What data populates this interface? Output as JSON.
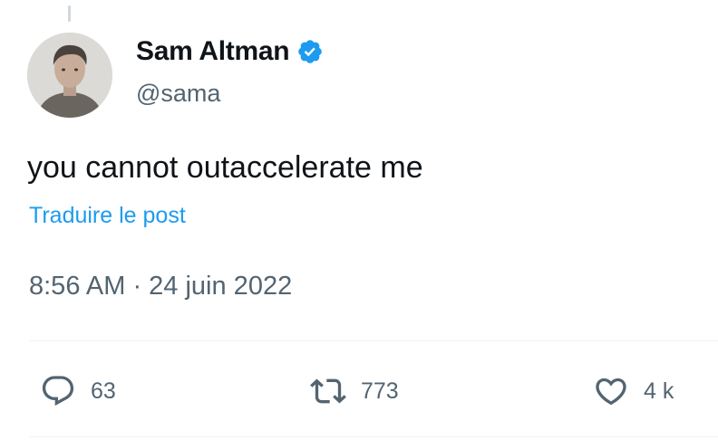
{
  "author": {
    "name": "Sam Altman",
    "handle": "@sama",
    "verified_badge_color": "#1d9bf0"
  },
  "post": {
    "text": "you cannot outaccelerate me",
    "translate_link": "Traduire le post",
    "timestamp": "8:56 AM · 24 juin 2022"
  },
  "actions": {
    "replies": {
      "icon": "reply-icon",
      "count": "63"
    },
    "reposts": {
      "icon": "repost-icon",
      "count": "773"
    },
    "likes": {
      "icon": "heart-icon",
      "count": "4 k"
    }
  },
  "colors": {
    "text": "#0f1419",
    "secondary": "#536471",
    "link": "#1d9bf0",
    "divider": "#eff3f4"
  }
}
